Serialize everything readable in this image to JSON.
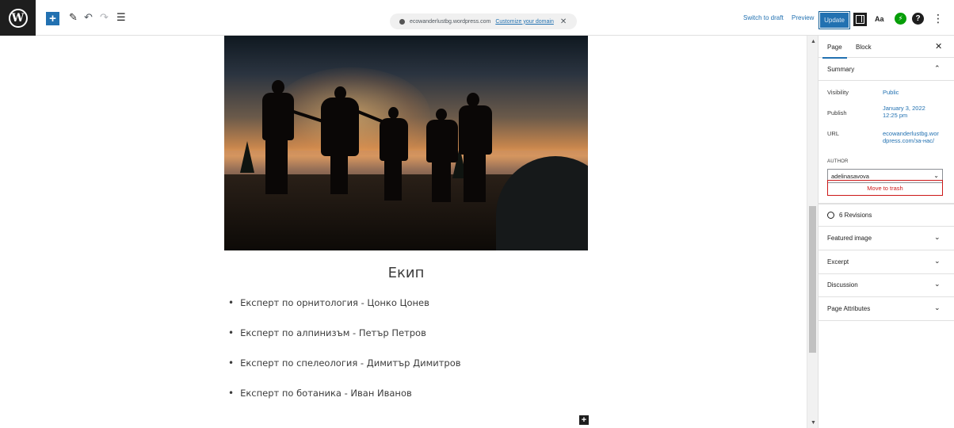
{
  "toolbar": {
    "logo": "W",
    "add": "+",
    "tools_icon": "✎",
    "undo_icon": "↶",
    "redo_icon": "↷",
    "list_view_icon": "☰",
    "url_domain": "ecowanderlustbg.wordpress.com",
    "customize_domain": "Customize your domain",
    "close": "✕",
    "switch_to_draft": "Switch to draft",
    "preview": "Preview",
    "update": "Update",
    "styles_icon": "Aa",
    "help_icon": "?",
    "more_icon": "⋮"
  },
  "content": {
    "heading": "Екип",
    "list": [
      "Експерт по орнитология - Цонко Цонев",
      "Експерт по алпинизъм - Петър Петров",
      "Експерт по спелеология - Димитър Димитров",
      "Експерт по ботаника - Иван Иванов"
    ],
    "add_block": "+"
  },
  "sidebar": {
    "tabs": [
      "Page",
      "Block"
    ],
    "close": "✕",
    "summary": {
      "title": "Summary",
      "visibility_label": "Visibility",
      "visibility_value": "Public",
      "publish_label": "Publish",
      "publish_line1": "January 3, 2022",
      "publish_line2": "12:25 pm",
      "url_label": "URL",
      "url_line1": "ecowanderlustbg.wor",
      "url_line2": "dpress.com/за-нас/",
      "author_label": "AUTHOR",
      "author_value": "adelinasavova",
      "trash": "Move to trash"
    },
    "revisions": "6 Revisions",
    "panels": [
      "Featured image",
      "Excerpt",
      "Discussion",
      "Page Attributes"
    ]
  },
  "colors": {
    "accent": "#2271b1",
    "danger": "#cc1818",
    "dark": "#1e1e1e"
  }
}
